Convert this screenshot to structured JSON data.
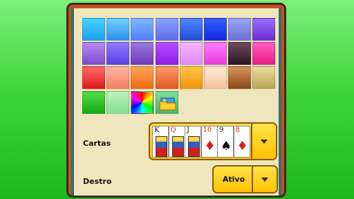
{
  "colors": {
    "background_top": "#7ef07a",
    "background_bottom": "#1db81c",
    "panel_face": "#efe6bd",
    "panel_frame": "#c8501a",
    "button_yellow": "#ffd22a"
  },
  "swatches": [
    {
      "name": "cyan-blue",
      "c1": "#45d3ff",
      "c2": "#1ba0f2"
    },
    {
      "name": "sky-blue",
      "c1": "#6fd0ff",
      "c2": "#2f8ff0"
    },
    {
      "name": "light-blue",
      "c1": "#7fb6ff",
      "c2": "#4e80ff"
    },
    {
      "name": "periwinkle",
      "c1": "#8aa0ff",
      "c2": "#5d6de8"
    },
    {
      "name": "medium-blue",
      "c1": "#4e86ff",
      "c2": "#1f4ed0"
    },
    {
      "name": "royal-blue",
      "c1": "#3460ff",
      "c2": "#1228e0"
    },
    {
      "name": "lavender-blue",
      "c1": "#9aa5f0",
      "c2": "#6a70d8"
    },
    {
      "name": "violet",
      "c1": "#9a6cff",
      "c2": "#6a2fd0"
    },
    {
      "name": "purple",
      "c1": "#b78af5",
      "c2": "#7a4dd0"
    },
    {
      "name": "indigo",
      "c1": "#8c7bff",
      "c2": "#5a3fe2"
    },
    {
      "name": "plum",
      "c1": "#9b7bdc",
      "c2": "#6d38b8"
    },
    {
      "name": "bright-purple",
      "c1": "#b84dff",
      "c2": "#8f1ee8"
    },
    {
      "name": "light-pink",
      "c1": "#f4b6ff",
      "c2": "#df8af5"
    },
    {
      "name": "magenta",
      "c1": "#ff7aff",
      "c2": "#e43fd8"
    },
    {
      "name": "dark-maroon",
      "c1": "#6e4a5a",
      "c2": "#2a1822"
    },
    {
      "name": "hot-pink",
      "c1": "#ff5ac0",
      "c2": "#ea1f86"
    },
    {
      "name": "red",
      "c1": "#ff6a6a",
      "c2": "#e2171b"
    },
    {
      "name": "salmon",
      "c1": "#ffb6a4",
      "c2": "#f27e60"
    },
    {
      "name": "orange",
      "c1": "#ffa55a",
      "c2": "#f26a10"
    },
    {
      "name": "burnt-orange",
      "c1": "#ff9a6a",
      "c2": "#e05a22"
    },
    {
      "name": "amber",
      "c1": "#ffc64a",
      "c2": "#f2920c"
    },
    {
      "name": "peach",
      "c1": "#ffe9d4",
      "c2": "#f5c29a"
    },
    {
      "name": "brown",
      "c1": "#d9925c",
      "c2": "#8a4a18"
    },
    {
      "name": "olive",
      "c1": "#ecdc9e",
      "c2": "#b8a656"
    },
    {
      "name": "green",
      "c1": "#52dd4a",
      "c2": "#13a812"
    },
    {
      "name": "mint",
      "c1": "#bff3c0",
      "c2": "#84dc8d"
    },
    {
      "name": "rainbow",
      "c1": "",
      "c2": ""
    },
    {
      "name": "custom-image",
      "c1": "#7bdf9a",
      "c2": "#49b56a"
    }
  ],
  "cards_label": "Cartas",
  "cards": [
    {
      "rank": "K",
      "suit": "♠",
      "color": "#111"
    },
    {
      "rank": "Q",
      "suit": "♥",
      "color": "#d81b1b"
    },
    {
      "rank": "J",
      "suit": "♠",
      "color": "#111"
    },
    {
      "rank": "10",
      "suit": "♦",
      "color": "#d81b1b"
    },
    {
      "rank": "9",
      "suit": "♠",
      "color": "#111"
    },
    {
      "rank": "8",
      "suit": "♦",
      "color": "#d81b1b"
    }
  ],
  "destro_label": "Destro",
  "destro_value": "Ativo",
  "icons": {
    "dropdown": "chevron-down-icon",
    "custom_image": "folder-image-icon"
  }
}
